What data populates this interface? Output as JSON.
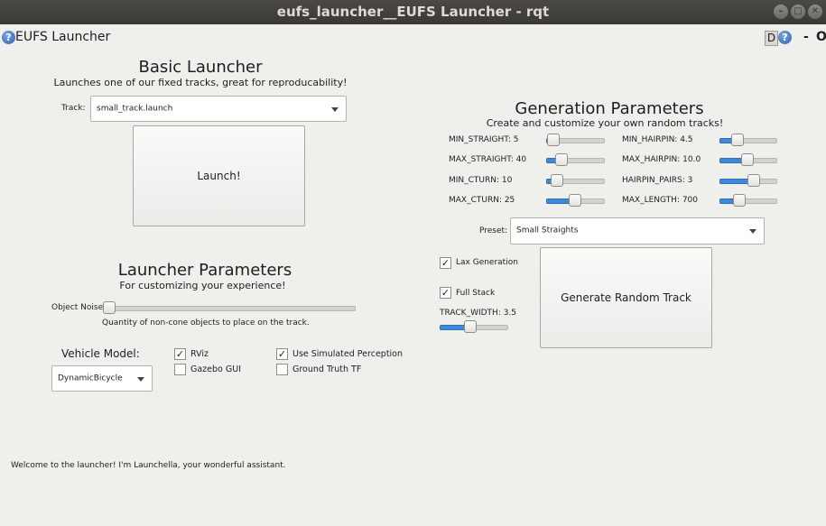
{
  "window": {
    "title": "eufs_launcher__EUFS Launcher - rqt",
    "min_glyph": "–",
    "max_glyph": "□",
    "close_glyph": "✕"
  },
  "plugin_bar": {
    "title": "EUFS Launcher",
    "help_glyph": "?",
    "d_label": "D",
    "dash": "-",
    "o_label": "O"
  },
  "basic": {
    "title": "Basic Launcher",
    "subtitle": "Launches one of our fixed tracks, great for reproducability!",
    "track_label": "Track:",
    "track_value": "small_track.launch",
    "launch_label": "Launch!"
  },
  "launcher_params": {
    "title": "Launcher Parameters",
    "subtitle": "For customizing your experience!",
    "object_noise_label": "Object Noise:",
    "object_noise_level": 0,
    "object_noise_desc": "Quantity of non-cone objects to place on the track.",
    "vehicle_model_label": "Vehicle Model:",
    "vehicle_model_value": "DynamicBicycle",
    "checks": {
      "rviz": {
        "label": "RViz",
        "checked": true,
        "glyph": "✓"
      },
      "gazebo": {
        "label": "Gazebo GUI",
        "checked": false,
        "glyph": ""
      },
      "sim_perception": {
        "label": "Use Simulated Perception",
        "checked": true,
        "glyph": "✓"
      },
      "ground_truth": {
        "label": "Ground Truth TF",
        "checked": false,
        "glyph": ""
      }
    }
  },
  "generation": {
    "title": "Generation Parameters",
    "subtitle": "Create and customize your own random tracks!",
    "params": {
      "min_straight": {
        "label": "MIN_STRAIGHT: 5",
        "level": 0.02
      },
      "max_straight": {
        "label": "MAX_STRAIGHT: 40",
        "level": 0.18
      },
      "min_cturn": {
        "label": "MIN_CTURN: 10",
        "level": 0.1
      },
      "max_cturn": {
        "label": "MAX_CTURN: 25",
        "level": 0.48
      },
      "min_hairpin": {
        "label": "MIN_HAIRPIN: 4.5",
        "level": 0.25
      },
      "max_hairpin": {
        "label": "MAX_HAIRPIN: 10.0",
        "level": 0.46
      },
      "hairpin_pairs": {
        "label": "HAIRPIN_PAIRS: 3",
        "level": 0.6
      },
      "max_length": {
        "label": "MAX_LENGTH: 700",
        "level": 0.28
      }
    },
    "preset_label": "Preset:",
    "preset_value": "Small Straights",
    "lax_generation": {
      "label": "Lax Generation",
      "checked": true,
      "glyph": "✓"
    },
    "full_stack": {
      "label": "Full Stack",
      "checked": true,
      "glyph": "✓"
    },
    "track_width_label": "TRACK_WIDTH: 3.5",
    "track_width_level": 0.42,
    "generate_label": "Generate Random Track"
  },
  "status": {
    "message": "Welcome to the launcher!  I'm Launchella, your wonderful assistant."
  },
  "colors": {
    "accent": "#3c8ad9",
    "titlebar": "#3f3e3a",
    "background": "#efefec"
  },
  "icons": {
    "help": "help-icon",
    "combo_arrow": "chevron-down-icon"
  }
}
